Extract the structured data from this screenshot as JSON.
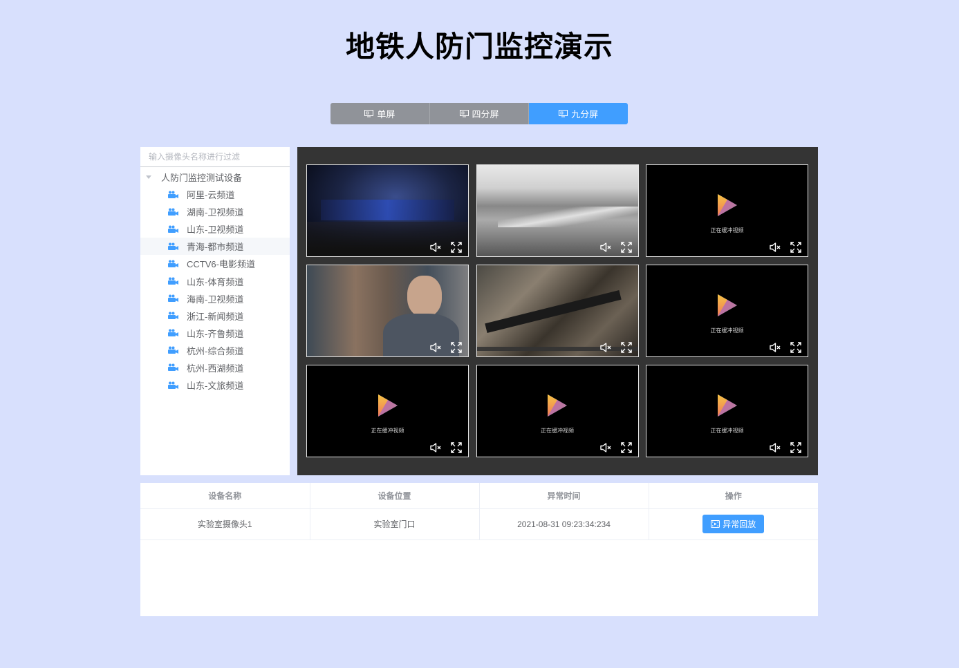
{
  "page": {
    "title": "地铁人防门监控演示"
  },
  "layout_switch": {
    "buttons": [
      {
        "label": "单屏",
        "active": false
      },
      {
        "label": "四分屏",
        "active": false
      },
      {
        "label": "九分屏",
        "active": true
      }
    ],
    "active_color": "#409eff",
    "inactive_color": "#909399"
  },
  "camera_tree": {
    "filter_placeholder": "输入摄像头名称进行过滤",
    "filter_value": "",
    "root_label": "人防门监控测试设备",
    "items": [
      {
        "label": "阿里-云频道"
      },
      {
        "label": "湖南-卫视频道"
      },
      {
        "label": "山东-卫视频道"
      },
      {
        "label": "青海-都市频道",
        "highlighted": true
      },
      {
        "label": "CCTV6-电影频道"
      },
      {
        "label": "山东-体育频道"
      },
      {
        "label": "海南-卫视频道"
      },
      {
        "label": "浙江-新闻频道"
      },
      {
        "label": "山东-齐鲁频道"
      },
      {
        "label": "杭州-综合频道"
      },
      {
        "label": "杭州-西湖频道"
      },
      {
        "label": "山东-文旅频道"
      }
    ],
    "icon": "video-camera-icon"
  },
  "video_grid": {
    "cells": [
      {
        "state": "playing",
        "scene": "conference-stage",
        "subtitle": ""
      },
      {
        "state": "playing",
        "scene": "grayscale-landscape",
        "subtitle": ""
      },
      {
        "state": "buffering",
        "buffer_text": "正在缓冲视频"
      },
      {
        "state": "playing",
        "scene": "drama-interior",
        "subtitle": ""
      },
      {
        "state": "playing",
        "scene": "rifle-closeup",
        "subtitle": ""
      },
      {
        "state": "buffering",
        "buffer_text": "正在缓冲视频"
      },
      {
        "state": "buffering",
        "buffer_text": "正在缓冲视频"
      },
      {
        "state": "buffering",
        "buffer_text": "正在缓冲视频"
      },
      {
        "state": "buffering",
        "buffer_text": "正在缓冲视频"
      }
    ],
    "controls": [
      "mute-icon",
      "fullscreen-icon"
    ]
  },
  "alarm_table": {
    "columns": [
      "设备名称",
      "设备位置",
      "异常时间",
      "操作"
    ],
    "rows": [
      {
        "device_name": "实验室摄像头1",
        "location": "实验室门口",
        "time": "2021-08-31 09:23:34:234",
        "action_label": "异常回放"
      }
    ]
  }
}
